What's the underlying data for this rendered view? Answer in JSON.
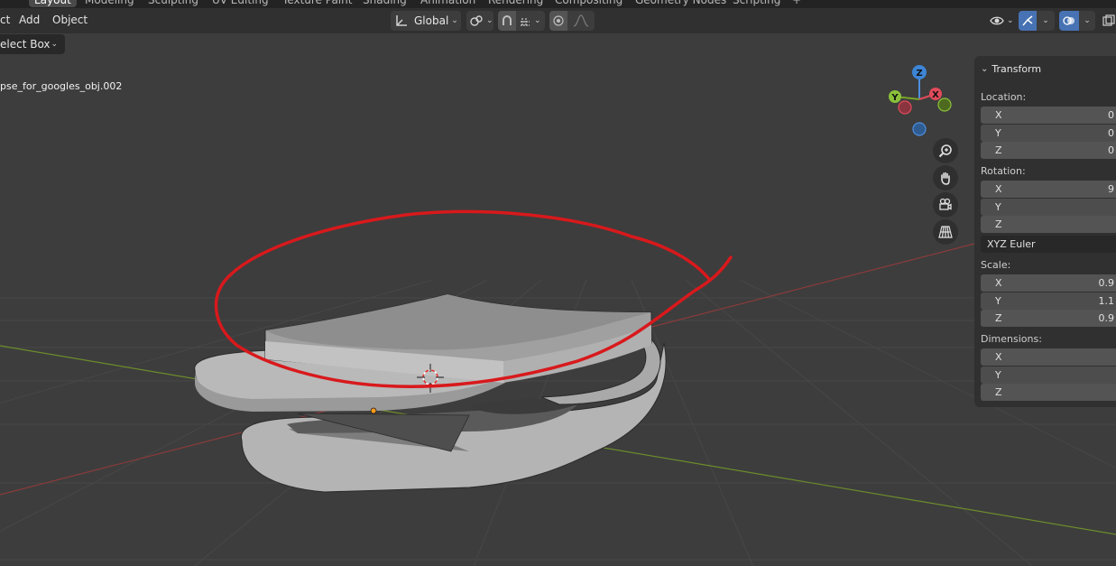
{
  "workspace_tabs": [
    "Layout",
    "Modeling",
    "Sculpting",
    "UV Editing",
    "Texture Paint",
    "Shading",
    "Animation",
    "Rendering",
    "Compositing",
    "Geometry Nodes",
    "Scripting"
  ],
  "header": {
    "menus": [
      "ct",
      "Add",
      "Object"
    ],
    "orientation": "Global"
  },
  "toolbar": {
    "select_mode": "elect Box"
  },
  "viewport": {
    "object_name": "pse_for_googles_obj.002",
    "gizmo": {
      "z": "Z",
      "y": "Y",
      "x": "X"
    },
    "annotation_color": "#d8191c"
  },
  "npanel": {
    "title": "Transform",
    "location_label": "Location:",
    "location": [
      {
        "axis": "X",
        "value": "0"
      },
      {
        "axis": "Y",
        "value": "0"
      },
      {
        "axis": "Z",
        "value": "0"
      }
    ],
    "rotation_label": "Rotation:",
    "rotation": [
      {
        "axis": "X",
        "value": "9"
      },
      {
        "axis": "Y",
        "value": ""
      },
      {
        "axis": "Z",
        "value": ""
      }
    ],
    "rotation_mode": "XYZ Euler",
    "scale_label": "Scale:",
    "scale": [
      {
        "axis": "X",
        "value": "0.9"
      },
      {
        "axis": "Y",
        "value": "1.1"
      },
      {
        "axis": "Z",
        "value": "0.9"
      }
    ],
    "dimensions_label": "Dimensions:",
    "dimensions": [
      {
        "axis": "X",
        "value": ""
      },
      {
        "axis": "Y",
        "value": ""
      },
      {
        "axis": "Z",
        "value": ""
      }
    ]
  }
}
